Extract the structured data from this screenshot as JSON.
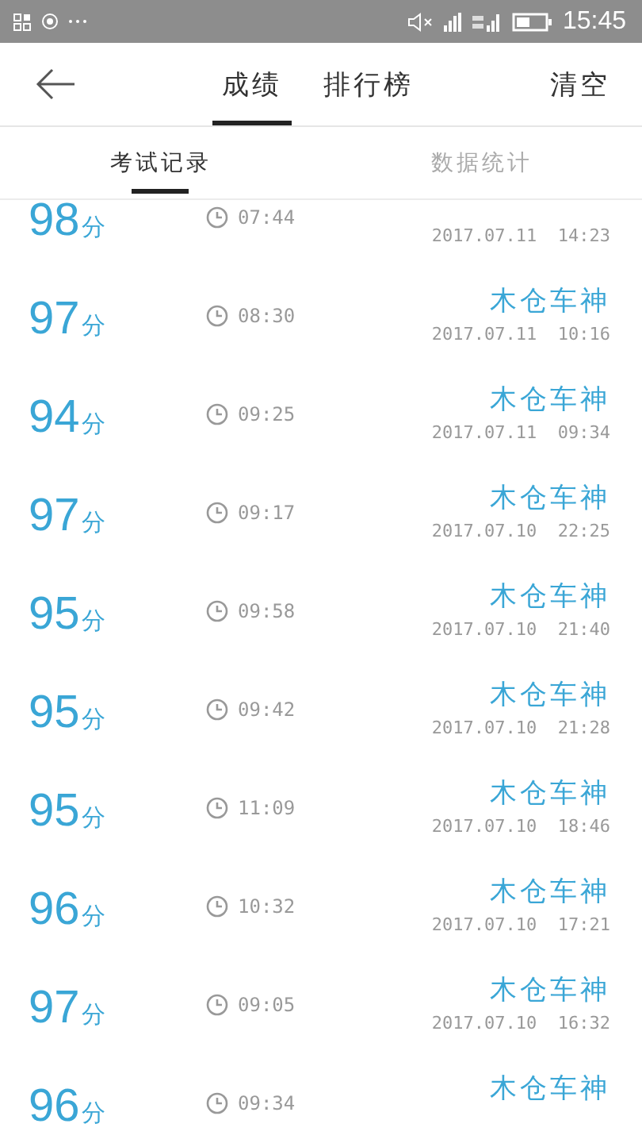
{
  "status_bar": {
    "time": "15:45"
  },
  "header": {
    "tabs": [
      {
        "label": "成绩",
        "selected": true
      },
      {
        "label": "排行榜",
        "selected": false
      }
    ],
    "action": "清空"
  },
  "subtabs": [
    {
      "label": "考试记录",
      "selected": true
    },
    {
      "label": "数据统计",
      "selected": false
    }
  ],
  "records": [
    {
      "score": "98",
      "unit": "分",
      "duration": "07:44",
      "date": "2017.07.11  14:23"
    },
    {
      "score": "97",
      "unit": "分",
      "duration": "08:30",
      "name": "木仓车神",
      "date": "2017.07.11  10:16"
    },
    {
      "score": "94",
      "unit": "分",
      "duration": "09:25",
      "name": "木仓车神",
      "date": "2017.07.11  09:34"
    },
    {
      "score": "97",
      "unit": "分",
      "duration": "09:17",
      "name": "木仓车神",
      "date": "2017.07.10  22:25"
    },
    {
      "score": "95",
      "unit": "分",
      "duration": "09:58",
      "name": "木仓车神",
      "date": "2017.07.10  21:40"
    },
    {
      "score": "95",
      "unit": "分",
      "duration": "09:42",
      "name": "木仓车神",
      "date": "2017.07.10  21:28"
    },
    {
      "score": "95",
      "unit": "分",
      "duration": "11:09",
      "name": "木仓车神",
      "date": "2017.07.10  18:46"
    },
    {
      "score": "96",
      "unit": "分",
      "duration": "10:32",
      "name": "木仓车神",
      "date": "2017.07.10  17:21"
    },
    {
      "score": "97",
      "unit": "分",
      "duration": "09:05",
      "name": "木仓车神",
      "date": "2017.07.10  16:32"
    },
    {
      "score": "96",
      "unit": "分",
      "duration": "09:34",
      "name": "木仓车神"
    }
  ]
}
